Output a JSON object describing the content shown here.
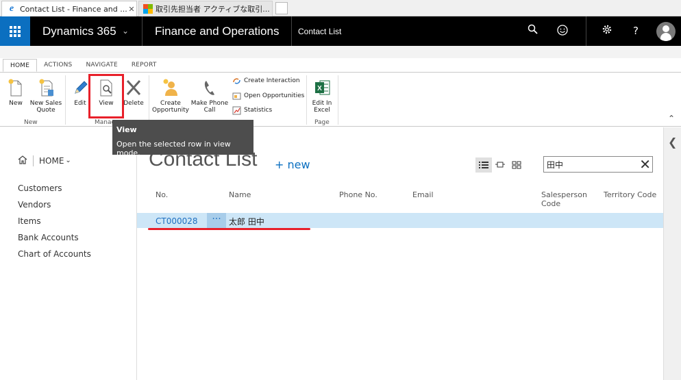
{
  "browser": {
    "tabs": [
      {
        "title": "Contact List - Finance and ...",
        "close": "✕"
      },
      {
        "title": "取引先担当者 アクティブな取引...",
        "close": ""
      }
    ]
  },
  "header": {
    "brand": "Dynamics 365",
    "module": "Finance and Operations",
    "page": "Contact List"
  },
  "ribbon": {
    "tabs": [
      "HOME",
      "ACTIONS",
      "NAVIGATE",
      "REPORT"
    ],
    "groups": {
      "new": {
        "label": "New",
        "buttons": {
          "new": "New",
          "new_sales_quote_1": "New Sales",
          "new_sales_quote_2": "Quote"
        }
      },
      "manage": {
        "label": "Manage",
        "buttons": {
          "edit": "Edit",
          "view": "View",
          "delete": "Delete"
        }
      },
      "activities": {
        "create_opportunity_1": "Create",
        "create_opportunity_2": "Opportunity",
        "make_phone_call_1": "Make Phone",
        "make_phone_call_2": "Call",
        "create_interaction": "Create Interaction",
        "open_opportunities": "Open Opportunities",
        "statistics": "Statistics"
      },
      "page": {
        "label": "Page",
        "edit_in_excel_1": "Edit In",
        "edit_in_excel_2": "Excel"
      }
    }
  },
  "tooltip": {
    "title": "View",
    "body": "Open the selected row in view mode."
  },
  "leftnav": {
    "home": "HOME",
    "items": [
      "Customers",
      "Vendors",
      "Items",
      "Bank Accounts",
      "Chart of Accounts"
    ]
  },
  "main": {
    "title": "Contact List",
    "new_label": "+ new",
    "search_value": "田中",
    "columns": {
      "no": "No.",
      "name": "Name",
      "phone": "Phone No.",
      "email": "Email",
      "salesperson_1": "Salesperson",
      "salesperson_2": "Code",
      "territory": "Territory Code"
    },
    "rows": [
      {
        "no": "CT000028",
        "name": "太郎 田中",
        "phone": "",
        "email": "",
        "salesperson": "",
        "territory": ""
      }
    ],
    "row_menu": "···"
  },
  "colors": {
    "accent": "#0b6fc0",
    "appbar": "#000000",
    "selected_row": "#cde6f7",
    "annotation_red": "#e8202a"
  }
}
